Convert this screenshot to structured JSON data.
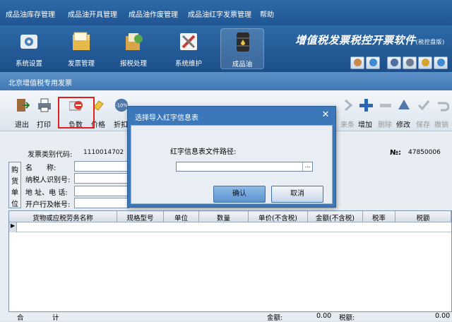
{
  "menu": [
    "成品油库存管理",
    "成品油开具管理",
    "成品油作废管理",
    "成品油红字发票管理",
    "帮助"
  ],
  "ribbon": [
    {
      "label": "系统设置",
      "icon": "gear-icon"
    },
    {
      "label": "发票管理",
      "icon": "folder-icon"
    },
    {
      "label": "报税处理",
      "icon": "tax-icon"
    },
    {
      "label": "系统维护",
      "icon": "tools-icon"
    },
    {
      "label": "成品油",
      "icon": "oil-barrel-icon"
    }
  ],
  "brand": {
    "title": "增值税发票税控开票软件",
    "suffix": "(税控盘版)"
  },
  "doc_title": "北京增值税专用发票",
  "toolbar": {
    "left": [
      "退出",
      "打印",
      "负数",
      "价格",
      "折扣"
    ],
    "right": [
      "来条",
      "增加",
      "删除",
      "修改",
      "保存",
      "撤销"
    ]
  },
  "invoice": {
    "code_label": "发票类别代码:",
    "code_value": "1110014702",
    "no_label": "№:",
    "no_value": "47850006",
    "buyer_box": [
      "购",
      "货",
      "单",
      "位"
    ],
    "buyer_fields": [
      "名　　称:",
      "纳税人识别号:",
      "地 址、电 话:",
      "开户行及帐号:"
    ]
  },
  "grid_headers": [
    "货物或应税劳务名称",
    "规格型号",
    "单位",
    "数量",
    "单价(不含税)",
    "金额(不含税)",
    "税率",
    "税额"
  ],
  "totals": {
    "label1": "合",
    "label2": "计",
    "amount_label": "金额:",
    "amount_value": "0.00",
    "tax_label": "税额:",
    "tax_value": "0.00"
  },
  "dialog": {
    "title": "选择导入红字信息表",
    "path_label": "红字信息表文件路径:",
    "path_value": "",
    "browse": "...",
    "ok": "确认",
    "cancel": "取消"
  },
  "colors": {
    "header_blue": "#1f5592",
    "highlight_red": "#e0201d",
    "dialog_blue": "#3c78b9"
  }
}
